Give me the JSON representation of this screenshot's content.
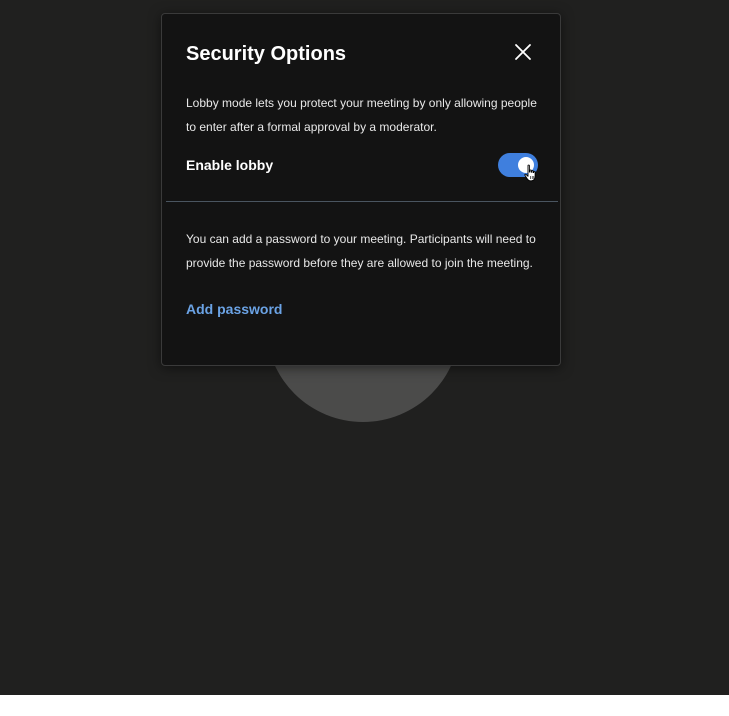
{
  "dialog": {
    "title": "Security Options",
    "close_icon": "close-icon"
  },
  "lobby": {
    "description": "Lobby mode lets you protect your meeting by only allowing people to enter after a formal approval by a moderator.",
    "label": "Enable lobby",
    "enabled": true,
    "toggle_color": "#3f7fde"
  },
  "password": {
    "description": "You can add a password to your meeting. Participants will need to provide the password before they are allowed to join the meeting.",
    "add_label": "Add password",
    "link_color": "#6ba3e5"
  },
  "cursor_icon": "hand-pointer-icon"
}
